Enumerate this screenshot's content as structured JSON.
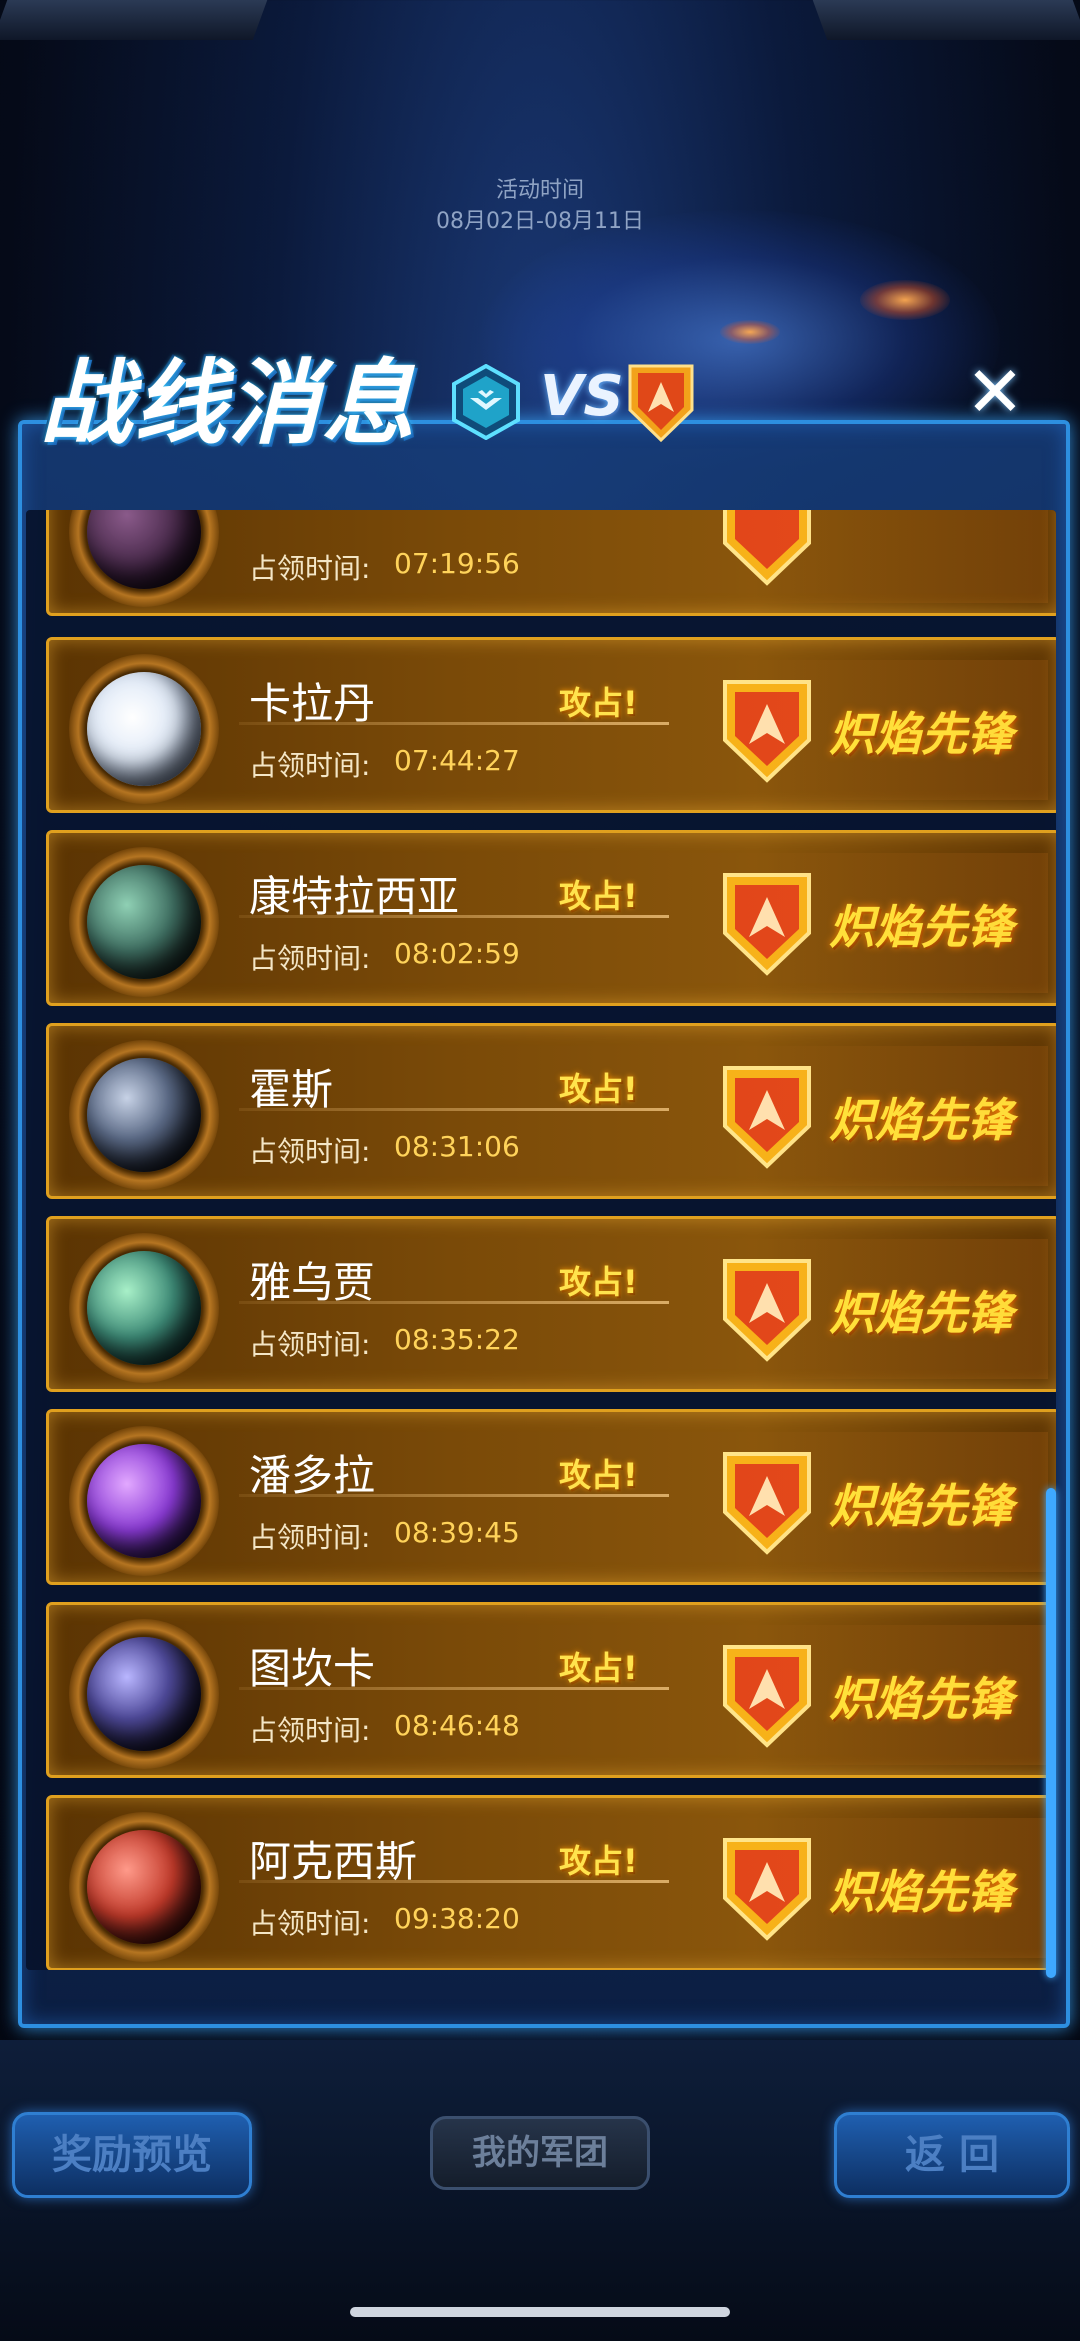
{
  "header": {
    "event_time_label": "活动时间",
    "event_time_range": "08月02日-08月11日",
    "title": "战线消息",
    "vs": "VS"
  },
  "colors": {
    "panel_border": "#2d8fe0",
    "row_border": "#e0a01e",
    "time_value": "#ffd35a",
    "faction": "#ffe53b"
  },
  "rows": [
    {
      "name": "",
      "occupy_label": "占领时间:",
      "time": "07:19:56",
      "attack": "",
      "faction": ""
    },
    {
      "name": "卡拉丹",
      "occupy_label": "占领时间:",
      "time": "07:44:27",
      "attack": "攻占!",
      "faction": "炽焰先锋"
    },
    {
      "name": "康特拉西亚",
      "occupy_label": "占领时间:",
      "time": "08:02:59",
      "attack": "攻占!",
      "faction": "炽焰先锋"
    },
    {
      "name": "霍斯",
      "occupy_label": "占领时间:",
      "time": "08:31:06",
      "attack": "攻占!",
      "faction": "炽焰先锋"
    },
    {
      "name": "雅乌贾",
      "occupy_label": "占领时间:",
      "time": "08:35:22",
      "attack": "攻占!",
      "faction": "炽焰先锋"
    },
    {
      "name": "潘多拉",
      "occupy_label": "占领时间:",
      "time": "08:39:45",
      "attack": "攻占!",
      "faction": "炽焰先锋"
    },
    {
      "name": "图坎卡",
      "occupy_label": "占领时间:",
      "time": "08:46:48",
      "attack": "攻占!",
      "faction": "炽焰先锋"
    },
    {
      "name": "阿克西斯",
      "occupy_label": "占领时间:",
      "time": "09:38:20",
      "attack": "攻占!",
      "faction": "炽焰先锋"
    }
  ],
  "footer": {
    "reward_preview": "奖励预览",
    "my_legion": "我的军团",
    "back": "返 回"
  }
}
